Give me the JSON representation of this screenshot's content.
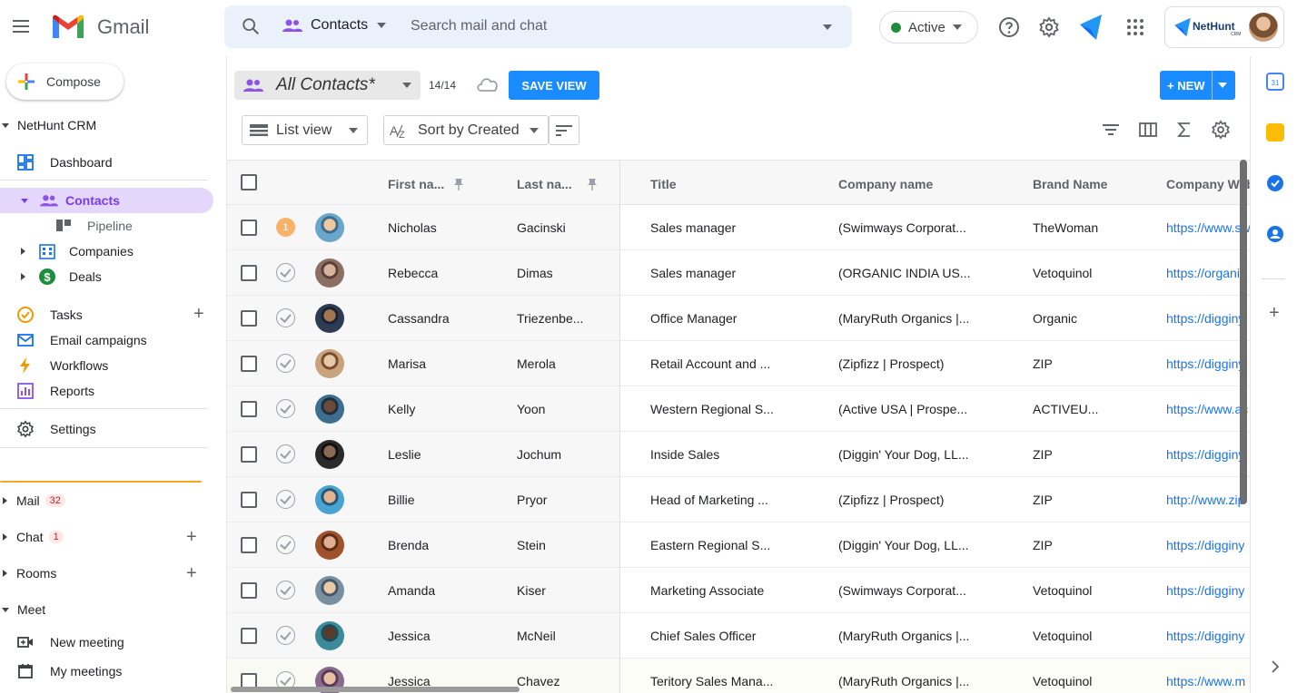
{
  "app": {
    "name": "Gmail",
    "search_scope": "Contacts",
    "search_placeholder": "Search mail and chat",
    "status": "Active",
    "brand": "NetHunt",
    "brand_sub": "CRM"
  },
  "sidebar": {
    "compose": "Compose",
    "crm_section": "NetHunt CRM",
    "items": [
      {
        "label": "Dashboard"
      },
      {
        "label": "Contacts"
      },
      {
        "label": "Pipeline"
      },
      {
        "label": "Companies"
      },
      {
        "label": "Deals"
      },
      {
        "label": "Tasks"
      },
      {
        "label": "Email campaigns"
      },
      {
        "label": "Workflows"
      },
      {
        "label": "Reports"
      },
      {
        "label": "Settings"
      }
    ],
    "sections": [
      {
        "label": "Mail",
        "badge": "32"
      },
      {
        "label": "Chat",
        "badge": "1"
      },
      {
        "label": "Rooms"
      },
      {
        "label": "Meet"
      }
    ],
    "meet_items": [
      {
        "label": "New meeting"
      },
      {
        "label": "My meetings"
      }
    ]
  },
  "toolbar": {
    "view_name": "All Contacts*",
    "count": "14/14",
    "save_view": "SAVE VIEW",
    "new_label": "+ NEW",
    "list_view": "List view",
    "sort_prefix": "Sort by ",
    "sort_field": "Created"
  },
  "table": {
    "headers": [
      "First na...",
      "Last na...",
      "Title",
      "Company name",
      "Brand Name",
      "Company Webs"
    ],
    "first_row_badge": "1",
    "rows": [
      {
        "first": "Nicholas",
        "last": "Gacinski",
        "title": "Sales manager",
        "company": "(Swimways Corporat...",
        "brand": "TheWoman",
        "web": "https://www.sw"
      },
      {
        "first": "Rebecca",
        "last": "Dimas",
        "title": "Sales manager",
        "company": "(ORGANIC INDIA US...",
        "brand": "Vetoquinol",
        "web": "https://organic"
      },
      {
        "first": "Cassandra",
        "last": "Triezenbe...",
        "title": "Office Manager",
        "company": "(MaryRuth Organics |...",
        "brand": "Organic",
        "web": "https://digginy"
      },
      {
        "first": "Marisa",
        "last": "Merola",
        "title": "Retail Account and ...",
        "company": "(Zipfizz | Prospect)",
        "brand": "ZIP",
        "web": "https://digginy"
      },
      {
        "first": "Kelly",
        "last": "Yoon",
        "title": "Western Regional S...",
        "company": "(Active USA | Prospe...",
        "brand": "ACTIVEU...",
        "web": "https://www.ac"
      },
      {
        "first": "Leslie",
        "last": "Jochum",
        "title": "Inside Sales",
        "company": "(Diggin' Your Dog, LL...",
        "brand": "ZIP",
        "web": "https://digginy"
      },
      {
        "first": "Billie",
        "last": "Pryor",
        "title": "Head of Marketing ...",
        "company": "(Zipfizz | Prospect)",
        "brand": "ZIP",
        "web": "http://www.zip"
      },
      {
        "first": "Brenda",
        "last": "Stein",
        "title": "Eastern Regional S...",
        "company": "(Diggin' Your Dog, LL...",
        "brand": "ZIP",
        "web": "https://digginy"
      },
      {
        "first": "Amanda",
        "last": "Kiser",
        "title": "Marketing Associate",
        "company": "(Swimways Corporat...",
        "brand": "Vetoquinol",
        "web": "https://digginy"
      },
      {
        "first": "Jessica",
        "last": "McNeil",
        "title": "Chief Sales Officer",
        "company": "(MaryRuth Organics |...",
        "brand": "Vetoquinol",
        "web": "https://digginy"
      },
      {
        "first": "Jessica",
        "last": "Chavez",
        "title": "Teritory Sales Mana...",
        "company": "(MaryRuth Organics |...",
        "brand": "Vetoquinol",
        "web": "https://www.m"
      }
    ]
  },
  "colors": {
    "accent": "#1a8cff",
    "crm_active_bg": "#e4d7fb",
    "crm_active_text": "#7c3aed",
    "link": "#1a73e8"
  }
}
